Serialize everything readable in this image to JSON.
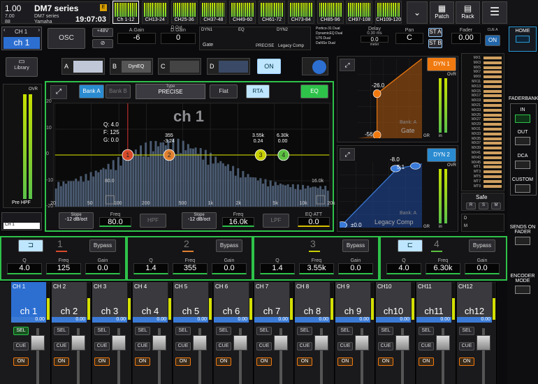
{
  "scene": {
    "number": "1.00",
    "name": "DM7 series",
    "version": "7.00",
    "maker_model": "DM7 series",
    "maker": "Yamaha",
    "scene_no": "88",
    "time": "19:07:03",
    "badge": "E"
  },
  "banks": [
    "Ch 1-12",
    "CH13-24",
    "CH25-36",
    "CH37-48",
    "CH49-60",
    "CH61-72",
    "CH73-84",
    "CH85-96",
    "CH97-108",
    "CH109-120"
  ],
  "top_buttons": {
    "patch": "Patch",
    "rack": "Rack"
  },
  "channel": {
    "sel_label": "CH 1",
    "name": "ch 1",
    "osc": "OSC",
    "phantom": "+48V",
    "again_label": "A.Gain",
    "again_val": "-6",
    "dgain_label": "D.Gain",
    "dgain_val": "0",
    "dout": "D.Out",
    "dgain_val2": "-12 dB/oct",
    "dyn1_tab": "DYN1",
    "eq_tab": "EQ",
    "dyn2_tab": "DYN2",
    "gate": "Gate",
    "precise": "PRECISE",
    "legacy": "Legacy Comp",
    "plugins": [
      "Portico-31 Dual",
      "DynamicEQ Dual",
      "U76 Dual",
      "DaNSe Dual"
    ],
    "delay_label": "Delay",
    "delay_ms": "0.30 ms",
    "delay_val": "0.0",
    "delay_unit": "meter",
    "pan_label": "Pan",
    "pan_val": "C",
    "st_a": "ST A",
    "st_b": "ST B",
    "fader_label": "Fader",
    "fader_val": "0.00",
    "cue_a": "CUE A",
    "on": "ON",
    "home": "HOME"
  },
  "inserts": {
    "library": "Library",
    "slots": [
      "A",
      "B",
      "C",
      "D"
    ],
    "slot_b": "DynEQ",
    "on": "ON",
    "ovr": "OVR",
    "pre_hpf": "Pre HPF",
    "ch1_small": "CH 1"
  },
  "eq": {
    "bank_a": "Bank A",
    "bank_b": "Bank B",
    "type_label": "Type",
    "type_val": "PRECISE",
    "flat": "Flat",
    "rta": "RTA",
    "eq": "EQ",
    "title": "ch 1",
    "info_q": "Q: 4.0",
    "info_f": "F: 125",
    "info_g": "G: 0.0",
    "lbl_355": "355",
    "lbl_324": "-3.24",
    "lbl_355k": "3.55k",
    "lbl_024": "0.24",
    "lbl_63k": "6.30k",
    "lbl_00": "0.00",
    "y_ticks": [
      "20",
      "10",
      "0",
      "-10",
      "-20"
    ],
    "x_ticks": [
      "20",
      "50",
      "100",
      "200",
      "500",
      "1k",
      "2k",
      "5k",
      "10k",
      "20k"
    ],
    "hpf_val_lbl": "80.0",
    "lpf_val_lbl": "16.0k",
    "hpf_slope_label": "Slope",
    "hpf_slope_val": "-12 dB/oct",
    "hpf_freq_label": "Freq",
    "hpf_freq_val": "80.0",
    "hpf": "HPF",
    "lpf_slope_label": "Slope",
    "lpf_slope_val": "-12 dB/oct",
    "lpf_freq_label": "Freq",
    "lpf_freq_val": "16.0k",
    "lpf": "LPF",
    "att_label": "EQ ATT",
    "att_val": "0.0"
  },
  "dyn1": {
    "button": "DYN 1",
    "thresh": "-26.0",
    "range": "-56",
    "bank": "Bank: A",
    "type": "Gate",
    "gr": "GR",
    "in": "in",
    "ovr": "OVR"
  },
  "dyn2": {
    "button": "DYN 2",
    "thresh": "-8.0",
    "ratio": "5:1",
    "gain": "±0.0",
    "bank": "Bank: A",
    "type": "Legacy Comp",
    "gr": "GR",
    "in": "in",
    "ovr": "OVR"
  },
  "mixbus": [
    "MX1",
    "MX3",
    "MX5",
    "MX7",
    "MX9",
    "MX11",
    "MX13",
    "MX15",
    "MX17",
    "MX19",
    "MX21",
    "MX23",
    "MX25",
    "MX27",
    "MX29",
    "MX31",
    "MX33",
    "MX35",
    "MX37",
    "MX39",
    "MX41",
    "MX43",
    "MX45",
    "MT1",
    "MT3",
    "MT5",
    "MT7",
    "MT9"
  ],
  "safe": {
    "label": "Safe",
    "r": "R",
    "s": "S",
    "m": "M",
    "d": "D",
    "m2": "M"
  },
  "right_panel": {
    "faderbank": "FADERBANK",
    "in": "IN",
    "out": "OUT",
    "dca": "DCA",
    "custom": "CUSTOM",
    "sends": "SENDS ON FADER",
    "encoder": "ENCODER MODE"
  },
  "bands": [
    {
      "num": "1",
      "bypass": "Bypass",
      "q": "4.0",
      "freq": "125",
      "gain": "0.0"
    },
    {
      "num": "2",
      "bypass": "Bypass",
      "q": "1.4",
      "freq": "355",
      "gain": "0.0"
    },
    {
      "num": "3",
      "bypass": "Bypass",
      "q": "1.4",
      "freq": "3.55k",
      "gain": "0.0"
    },
    {
      "num": "4",
      "bypass": "Bypass",
      "q": "4.0",
      "freq": "6.30k",
      "gain": "0.0"
    }
  ],
  "band_labels": {
    "q": "Q",
    "freq": "Freq",
    "gain": "Gain"
  },
  "strips": [
    {
      "id": "CH 1",
      "name": "ch 1",
      "val": "0.00",
      "sel": true
    },
    {
      "id": "CH 2",
      "name": "ch 2",
      "val": "0.00"
    },
    {
      "id": "CH 3",
      "name": "ch 3",
      "val": "0.00"
    },
    {
      "id": "CH 4",
      "name": "ch 4",
      "val": "0.00"
    },
    {
      "id": "CH 5",
      "name": "ch 5",
      "val": "0.00"
    },
    {
      "id": "CH 6",
      "name": "ch 6",
      "val": "0.00"
    },
    {
      "id": "CH 7",
      "name": "ch 7",
      "val": "0.00"
    },
    {
      "id": "CH 8",
      "name": "ch 8",
      "val": "0.00"
    },
    {
      "id": "CH 9",
      "name": "ch 9",
      "val": "0.00"
    },
    {
      "id": "CH10",
      "name": "ch10",
      "val": "0.00"
    },
    {
      "id": "CH11",
      "name": "ch11",
      "val": "0.00"
    },
    {
      "id": "CH12",
      "name": "ch12",
      "val": "0.00"
    }
  ],
  "strip_buttons": {
    "sel": "SEL",
    "cue": "CUE",
    "on": "ON"
  }
}
